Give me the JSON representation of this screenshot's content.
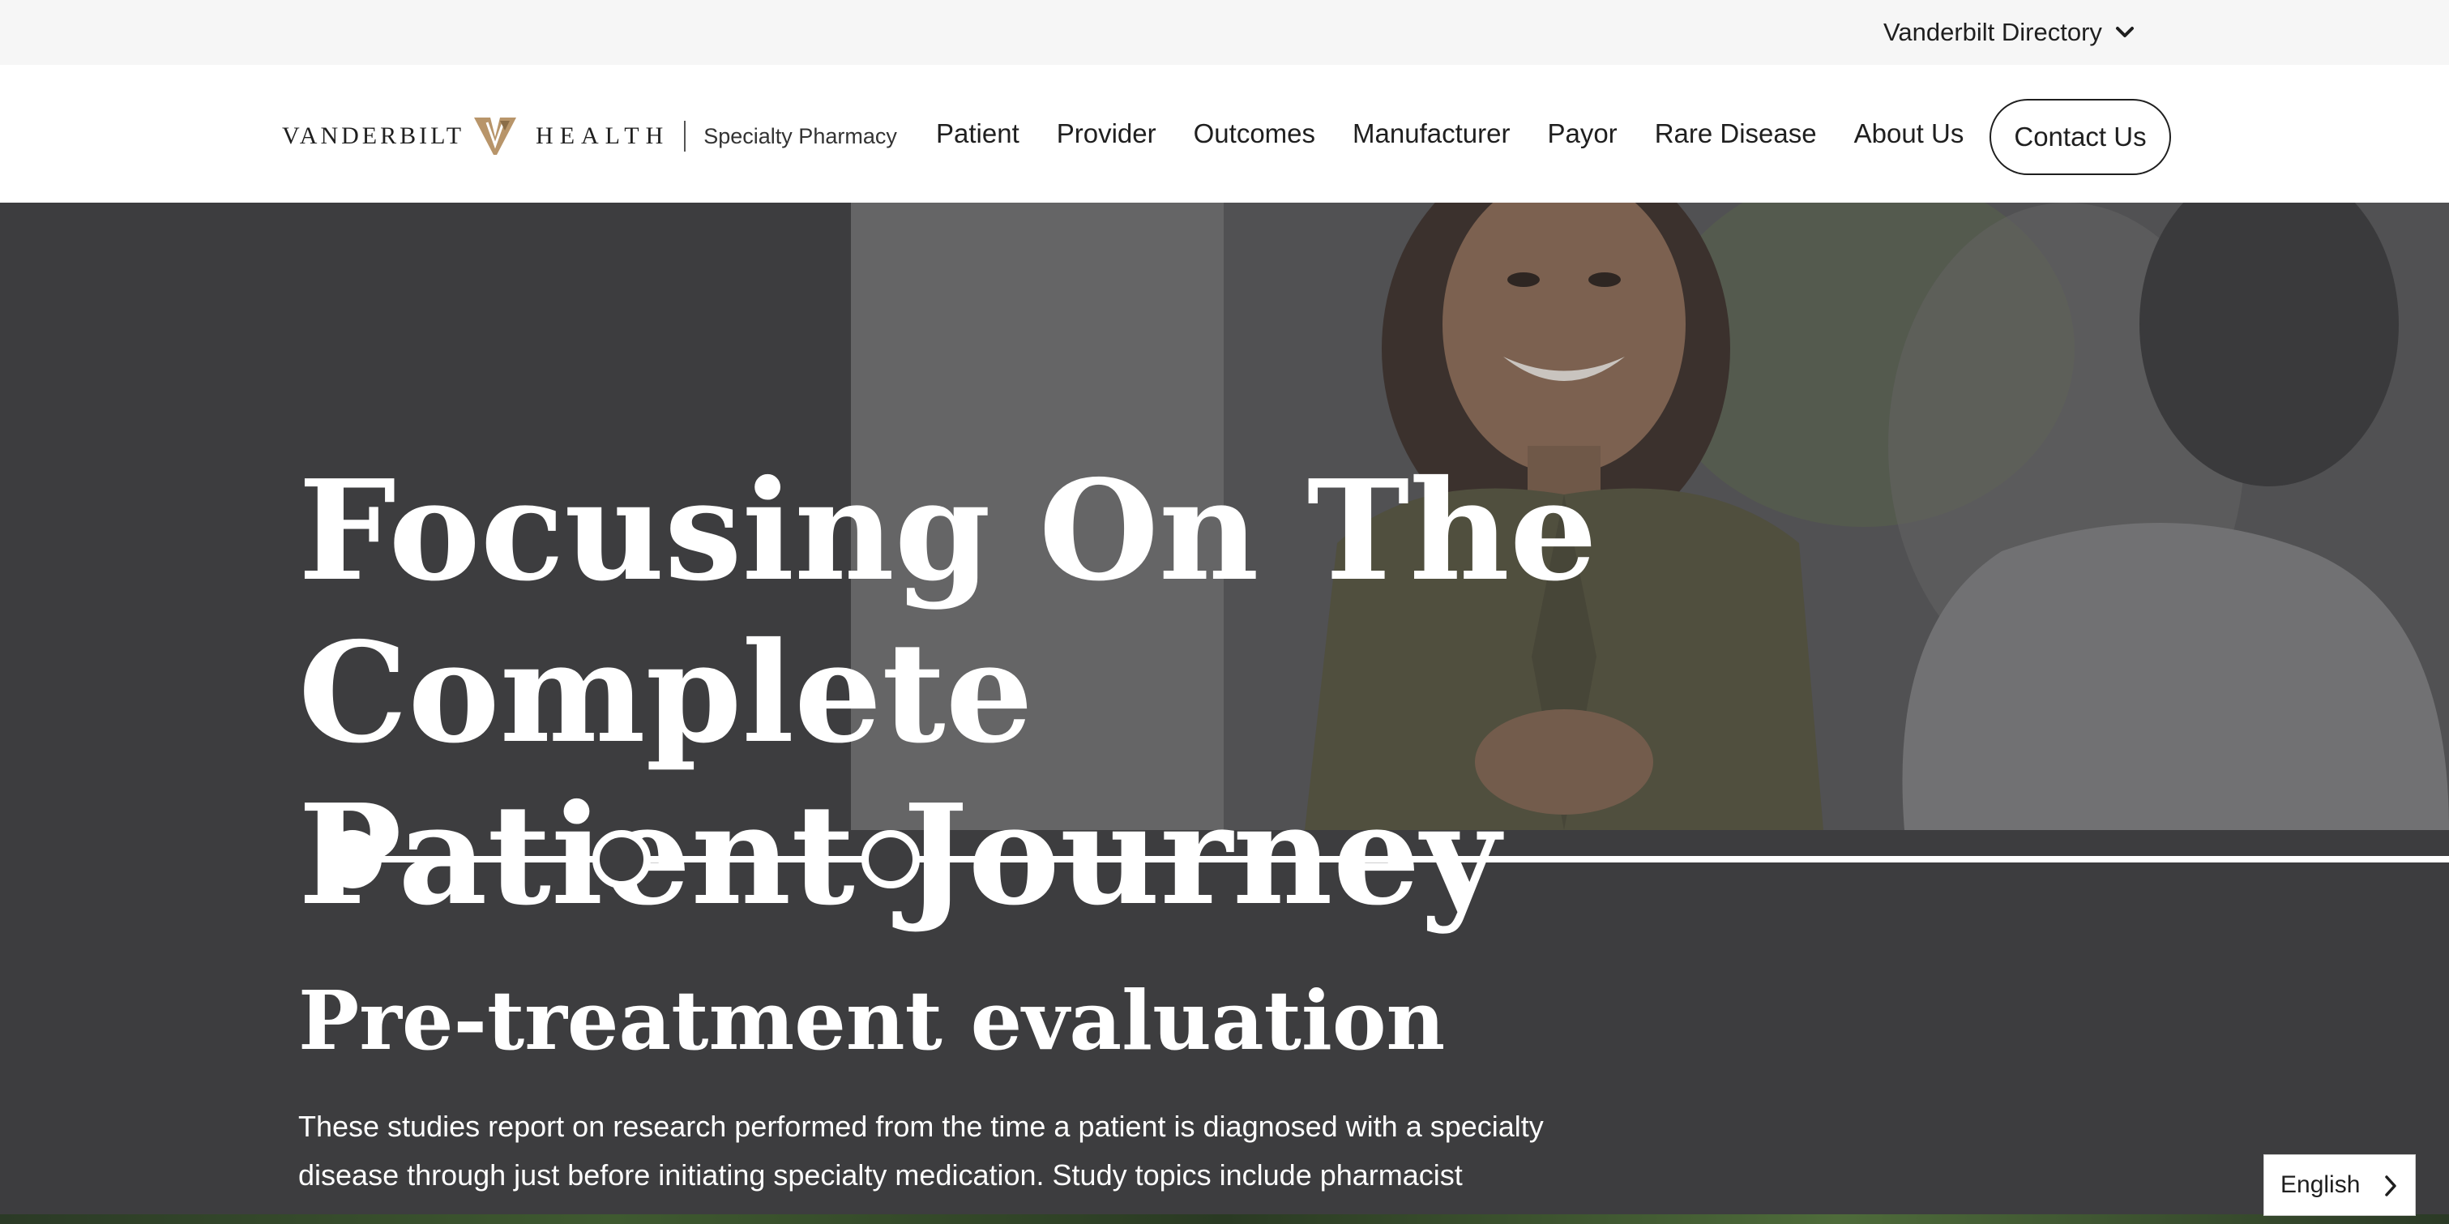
{
  "utility_bar": {
    "directory_label": "Vanderbilt Directory",
    "directory_icon": "chevron-down-icon"
  },
  "header": {
    "logo": {
      "word1": "VANDERBILT",
      "word2": "HEALTH",
      "subtitle": "Specialty Pharmacy",
      "mark_color": "#b8956a"
    },
    "nav": [
      {
        "label": "Patient"
      },
      {
        "label": "Provider"
      },
      {
        "label": "Outcomes"
      },
      {
        "label": "Manufacturer"
      },
      {
        "label": "Payor"
      },
      {
        "label": "Rare Disease"
      },
      {
        "label": "About Us"
      }
    ],
    "contact_label": "Contact Us"
  },
  "hero": {
    "title_line1": "Focusing On The Complete",
    "title_line2": "Patient Journey",
    "timeline": {
      "steps": 3,
      "active_index": 0
    },
    "section_title": "Pre-treatment evaluation",
    "section_body": "These studies report on research performed from the time a patient is diagnosed with a specialty disease through just before initiating specialty medication. Study topics include pharmacist"
  },
  "language": {
    "label": "English",
    "icon": "chevron-right-icon"
  },
  "colors": {
    "hero_bg": "#3d3d3f",
    "utility_bg": "#f6f6f6",
    "text_dark": "#1f1f1f",
    "white": "#ffffff"
  }
}
